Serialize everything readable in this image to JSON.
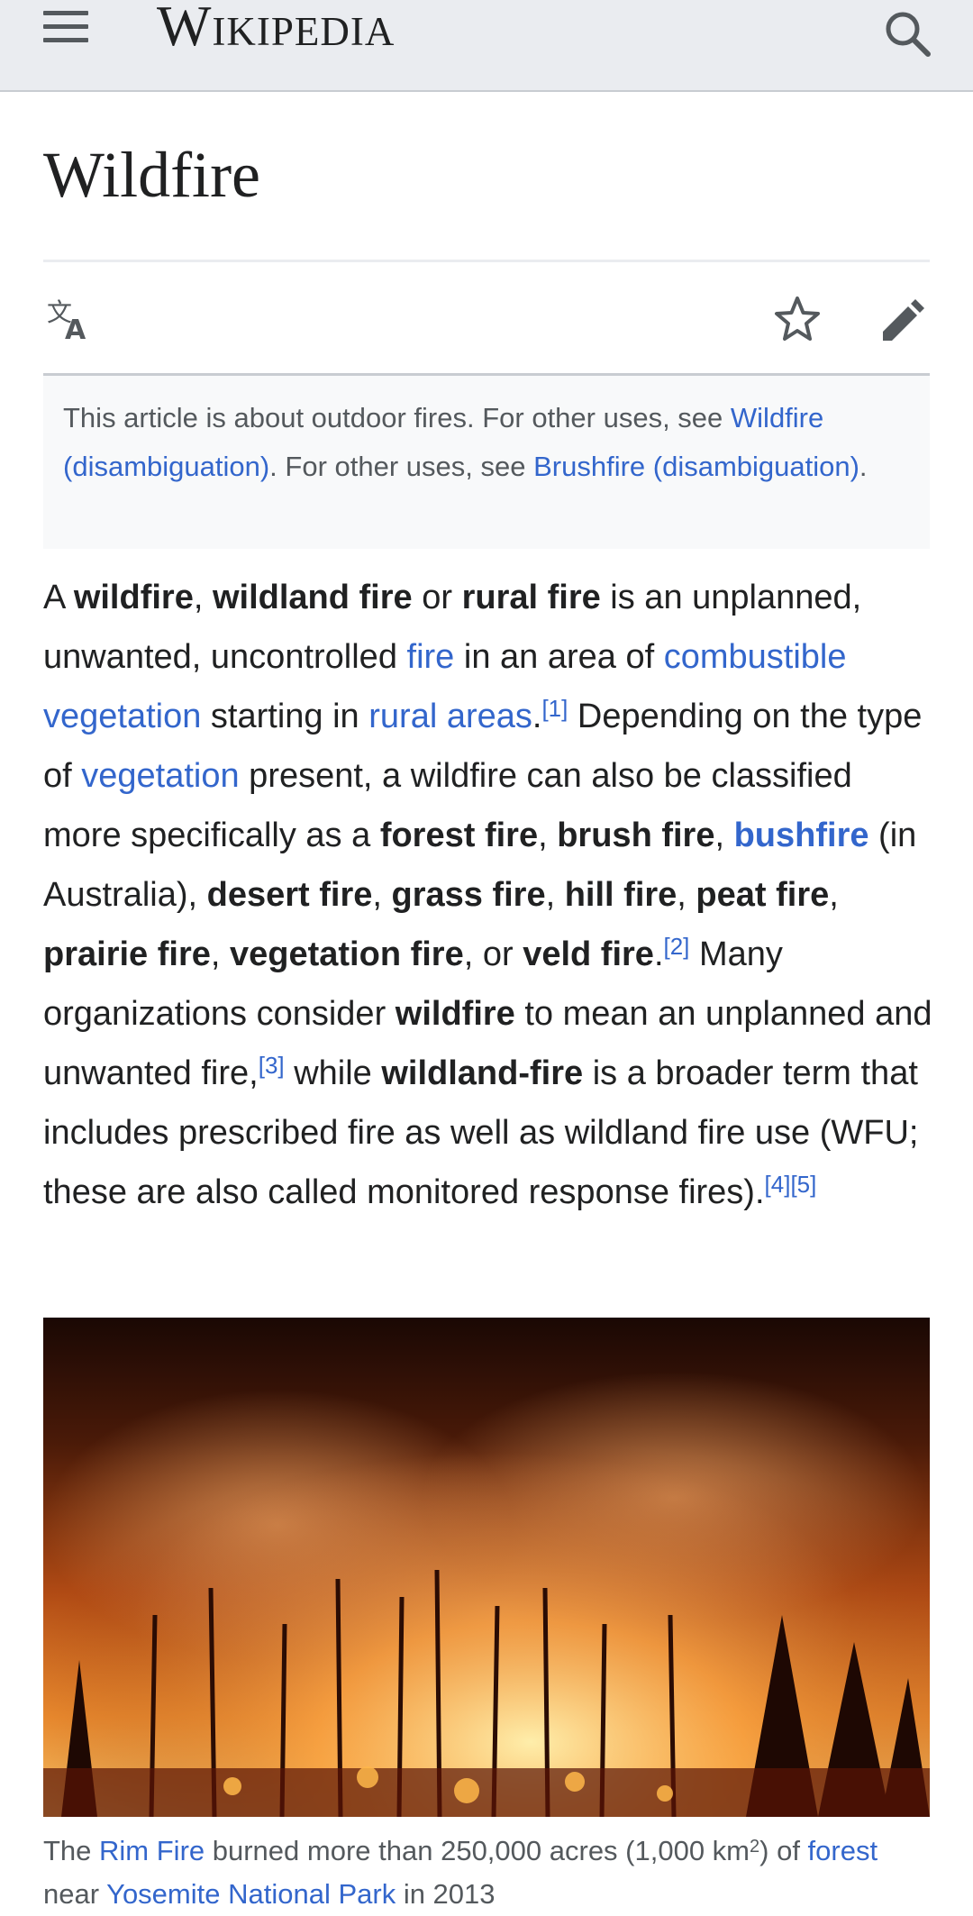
{
  "header": {
    "wordmark": "Wikipedia",
    "menu_icon": "hamburger-menu-icon",
    "search_icon": "search-icon"
  },
  "page": {
    "title": "Wildfire",
    "actions": {
      "language_icon": "language-icon",
      "watch_icon": "star-icon",
      "edit_icon": "pencil-icon"
    }
  },
  "hatnote": {
    "t1": "This article is about outdoor fires. For other uses, see ",
    "l1": "Wildfire (disambiguation)",
    "t2": ". For other uses, see ",
    "l2": "Brushfire (disambiguation)",
    "t3": "."
  },
  "lead": {
    "s1": "A ",
    "b1": "wildfire",
    "s2": ", ",
    "b2": "wildland fire",
    "s3": " or ",
    "b3": "rural fire",
    "s4": " is an unplanned, unwanted, uncontrolled ",
    "l1": "fire",
    "s5": " in an area of ",
    "l2": "combustible vegetation",
    "s6": " starting in ",
    "l3": "rural areas",
    "s7": ".",
    "r1": "[1]",
    "s8": " Depending on the type of ",
    "l4": "vegetation",
    "s9": " present, a wildfire can also be classified more specifically as a ",
    "b4": "forest fire",
    "s10": ", ",
    "b5": "brush fire",
    "s11": ", ",
    "lb1": "bushfire",
    "s12": " (in Australia), ",
    "b6": "desert fire",
    "s13": ", ",
    "b7": "grass fire",
    "s14": ", ",
    "b8": "hill fire",
    "s15": ", ",
    "b9": "peat fire",
    "s16": ", ",
    "b10": "prairie fire",
    "s17": ", ",
    "b11": "vegetation fire",
    "s18": ", or ",
    "b12": "veld fire",
    "s19": ".",
    "r2": "[2]",
    "s20": " Many organizations consider ",
    "b13": "wildfire",
    "s21": " to mean an unplanned and unwanted fire,",
    "r3": "[3]",
    "s22": " while ",
    "b14": "wildland-fire",
    "s23": " is a broader term that includes prescribed fire as well as wildland fire use (WFU; these are also called monitored response fires).",
    "r4": "[4]",
    "r5": "[5]"
  },
  "figure": {
    "c1": "The ",
    "l1": "Rim Fire",
    "c2": " burned more than 250,000 acres (1,000 km",
    "sup": "2",
    "c3": ") of ",
    "l2": "forest",
    "c4": "near ",
    "l3": "Yosemite National Park",
    "c5": " in 2013"
  },
  "colors": {
    "link": "#3366cc",
    "header_bg": "#eaecf0",
    "hatnote_bg": "#f8f9fa",
    "text": "#202122"
  }
}
